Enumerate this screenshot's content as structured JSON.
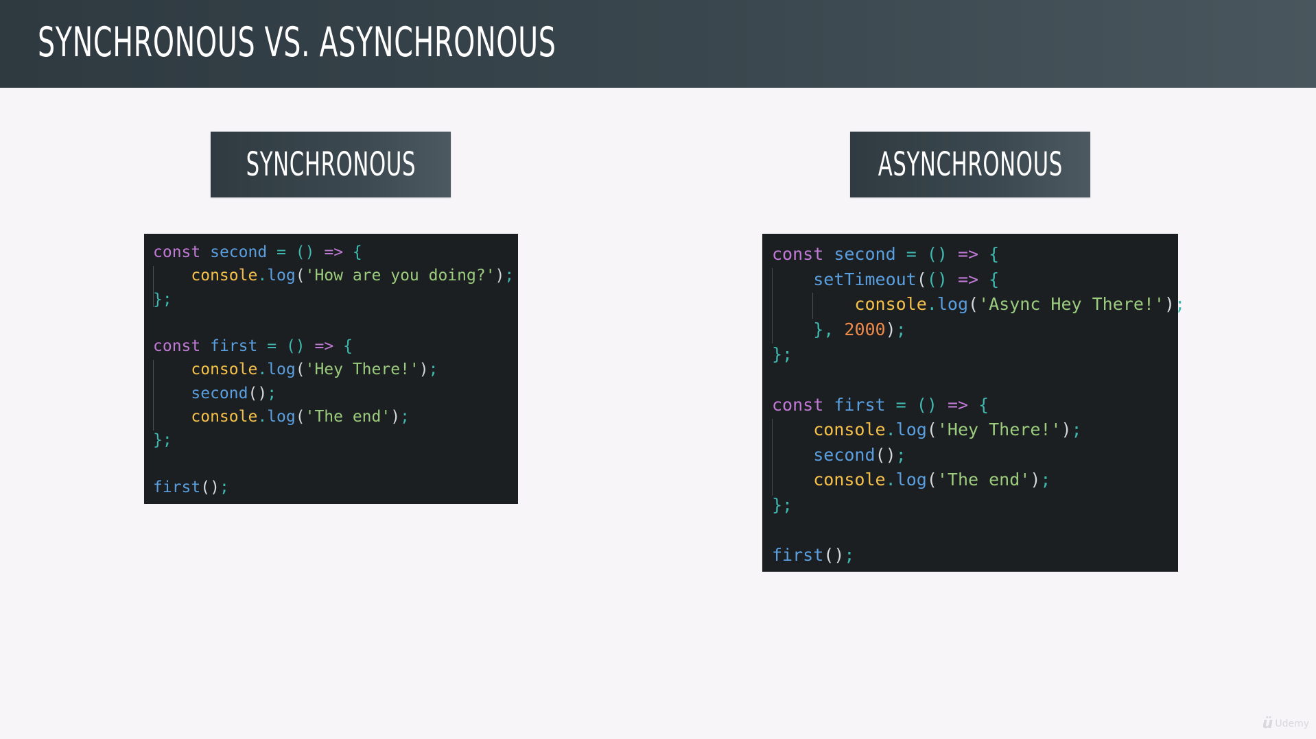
{
  "header": {
    "title": "SYNCHRONOUS VS. ASYNCHRONOUS"
  },
  "labels": {
    "synchronous": "SYNCHRONOUS",
    "asynchronous": "ASYNCHRONOUS"
  },
  "colors": {
    "keyword": "#c07ad6",
    "function": "#5a9fe0",
    "operator": "#3fb8b0",
    "object": "#f5c14a",
    "string": "#9ccc7d",
    "number": "#f08a4b",
    "panel_background": "#1c1f22",
    "page_background": "#f7f5f8"
  },
  "code_sync": [
    [
      [
        "kw",
        "const"
      ],
      [
        "txt",
        " "
      ],
      [
        "fn",
        "second"
      ],
      [
        "txt",
        " "
      ],
      [
        "op",
        "="
      ],
      [
        "txt",
        " "
      ],
      [
        "op",
        "()"
      ],
      [
        "txt",
        " "
      ],
      [
        "kw",
        "=>"
      ],
      [
        "txt",
        " "
      ],
      [
        "op",
        "{"
      ]
    ],
    [
      [
        "txt",
        "    "
      ],
      [
        "obj",
        "console"
      ],
      [
        "op",
        "."
      ],
      [
        "fn",
        "log"
      ],
      [
        "txt",
        "("
      ],
      [
        "str",
        "'How are you doing?'"
      ],
      [
        "txt",
        ")"
      ],
      [
        "op",
        ";"
      ]
    ],
    [
      [
        "op",
        "};"
      ]
    ],
    [],
    [
      [
        "kw",
        "const"
      ],
      [
        "txt",
        " "
      ],
      [
        "fn",
        "first"
      ],
      [
        "txt",
        " "
      ],
      [
        "op",
        "="
      ],
      [
        "txt",
        " "
      ],
      [
        "op",
        "()"
      ],
      [
        "txt",
        " "
      ],
      [
        "kw",
        "=>"
      ],
      [
        "txt",
        " "
      ],
      [
        "op",
        "{"
      ]
    ],
    [
      [
        "txt",
        "    "
      ],
      [
        "obj",
        "console"
      ],
      [
        "op",
        "."
      ],
      [
        "fn",
        "log"
      ],
      [
        "txt",
        "("
      ],
      [
        "str",
        "'Hey There!'"
      ],
      [
        "txt",
        ")"
      ],
      [
        "op",
        ";"
      ]
    ],
    [
      [
        "txt",
        "    "
      ],
      [
        "fn",
        "second"
      ],
      [
        "txt",
        "()"
      ],
      [
        "op",
        ";"
      ]
    ],
    [
      [
        "txt",
        "    "
      ],
      [
        "obj",
        "console"
      ],
      [
        "op",
        "."
      ],
      [
        "fn",
        "log"
      ],
      [
        "txt",
        "("
      ],
      [
        "str",
        "'The end'"
      ],
      [
        "txt",
        ")"
      ],
      [
        "op",
        ";"
      ]
    ],
    [
      [
        "op",
        "};"
      ]
    ],
    [],
    [
      [
        "fn",
        "first"
      ],
      [
        "txt",
        "()"
      ],
      [
        "op",
        ";"
      ]
    ]
  ],
  "code_async": [
    [
      [
        "kw",
        "const"
      ],
      [
        "txt",
        " "
      ],
      [
        "fn",
        "second"
      ],
      [
        "txt",
        " "
      ],
      [
        "op",
        "="
      ],
      [
        "txt",
        " "
      ],
      [
        "op",
        "()"
      ],
      [
        "txt",
        " "
      ],
      [
        "kw",
        "=>"
      ],
      [
        "txt",
        " "
      ],
      [
        "op",
        "{"
      ]
    ],
    [
      [
        "txt",
        "    "
      ],
      [
        "fn",
        "setTimeout"
      ],
      [
        "txt",
        "("
      ],
      [
        "op",
        "()"
      ],
      [
        "txt",
        " "
      ],
      [
        "kw",
        "=>"
      ],
      [
        "txt",
        " "
      ],
      [
        "op",
        "{"
      ]
    ],
    [
      [
        "txt",
        "        "
      ],
      [
        "obj",
        "console"
      ],
      [
        "op",
        "."
      ],
      [
        "fn",
        "log"
      ],
      [
        "txt",
        "("
      ],
      [
        "str",
        "'Async Hey There!'"
      ],
      [
        "txt",
        ")"
      ],
      [
        "op",
        ";"
      ]
    ],
    [
      [
        "txt",
        "    "
      ],
      [
        "op",
        "},"
      ],
      [
        "txt",
        " "
      ],
      [
        "num",
        "2000"
      ],
      [
        "txt",
        ")"
      ],
      [
        "op",
        ";"
      ]
    ],
    [
      [
        "op",
        "};"
      ]
    ],
    [],
    [
      [
        "kw",
        "const"
      ],
      [
        "txt",
        " "
      ],
      [
        "fn",
        "first"
      ],
      [
        "txt",
        " "
      ],
      [
        "op",
        "="
      ],
      [
        "txt",
        " "
      ],
      [
        "op",
        "()"
      ],
      [
        "txt",
        " "
      ],
      [
        "kw",
        "=>"
      ],
      [
        "txt",
        " "
      ],
      [
        "op",
        "{"
      ]
    ],
    [
      [
        "txt",
        "    "
      ],
      [
        "obj",
        "console"
      ],
      [
        "op",
        "."
      ],
      [
        "fn",
        "log"
      ],
      [
        "txt",
        "("
      ],
      [
        "str",
        "'Hey There!'"
      ],
      [
        "txt",
        ")"
      ],
      [
        "op",
        ";"
      ]
    ],
    [
      [
        "txt",
        "    "
      ],
      [
        "fn",
        "second"
      ],
      [
        "txt",
        "()"
      ],
      [
        "op",
        ";"
      ]
    ],
    [
      [
        "txt",
        "    "
      ],
      [
        "obj",
        "console"
      ],
      [
        "op",
        "."
      ],
      [
        "fn",
        "log"
      ],
      [
        "txt",
        "("
      ],
      [
        "str",
        "'The end'"
      ],
      [
        "txt",
        ")"
      ],
      [
        "op",
        ";"
      ]
    ],
    [
      [
        "op",
        "};"
      ]
    ],
    [],
    [
      [
        "fn",
        "first"
      ],
      [
        "txt",
        "()"
      ],
      [
        "op",
        ";"
      ]
    ]
  ],
  "watermark": {
    "icon": "udemy-logo-icon",
    "text": "Udemy"
  }
}
